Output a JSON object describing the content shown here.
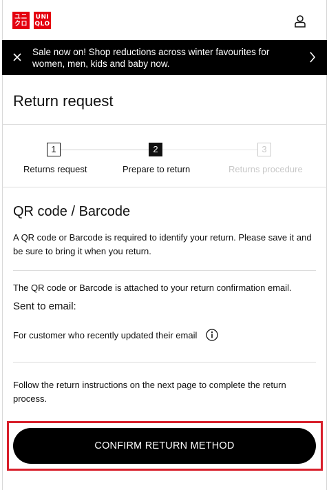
{
  "header": {
    "logo_top": "UNI",
    "logo_bottom": "QLO",
    "logo_top_kana": "ユニ",
    "logo_bottom_kana": "クロ"
  },
  "banner": {
    "text": "Sale now on! Shop reductions across winter favourites for women, men, kids and baby now.",
    "background": "#000000"
  },
  "page": {
    "title": "Return request"
  },
  "steps": [
    {
      "number": "1",
      "label": "Returns request",
      "state": "done"
    },
    {
      "number": "2",
      "label": "Prepare to return",
      "state": "current"
    },
    {
      "number": "3",
      "label": "Returns procedure",
      "state": "upcoming"
    }
  ],
  "section": {
    "title": "QR code / Barcode",
    "intro": "A QR code or Barcode is required to identify your return. Please save it and be sure to bring it when you return.",
    "attached": "The QR code or Barcode is attached to your return confirmation email.",
    "sent_to": "Sent to email:",
    "updated_email": "For customer who recently updated their email",
    "follow": "Follow the return instructions on the next page to complete the return process."
  },
  "cta": {
    "label": "CONFIRM RETURN METHOD"
  },
  "colors": {
    "brand": "#e4000f",
    "highlight": "#d81e2a",
    "cta": "#000000"
  },
  "icons": {
    "account": "account-icon",
    "close": "close-icon",
    "next": "chevron-right-icon",
    "info": "info-icon"
  }
}
